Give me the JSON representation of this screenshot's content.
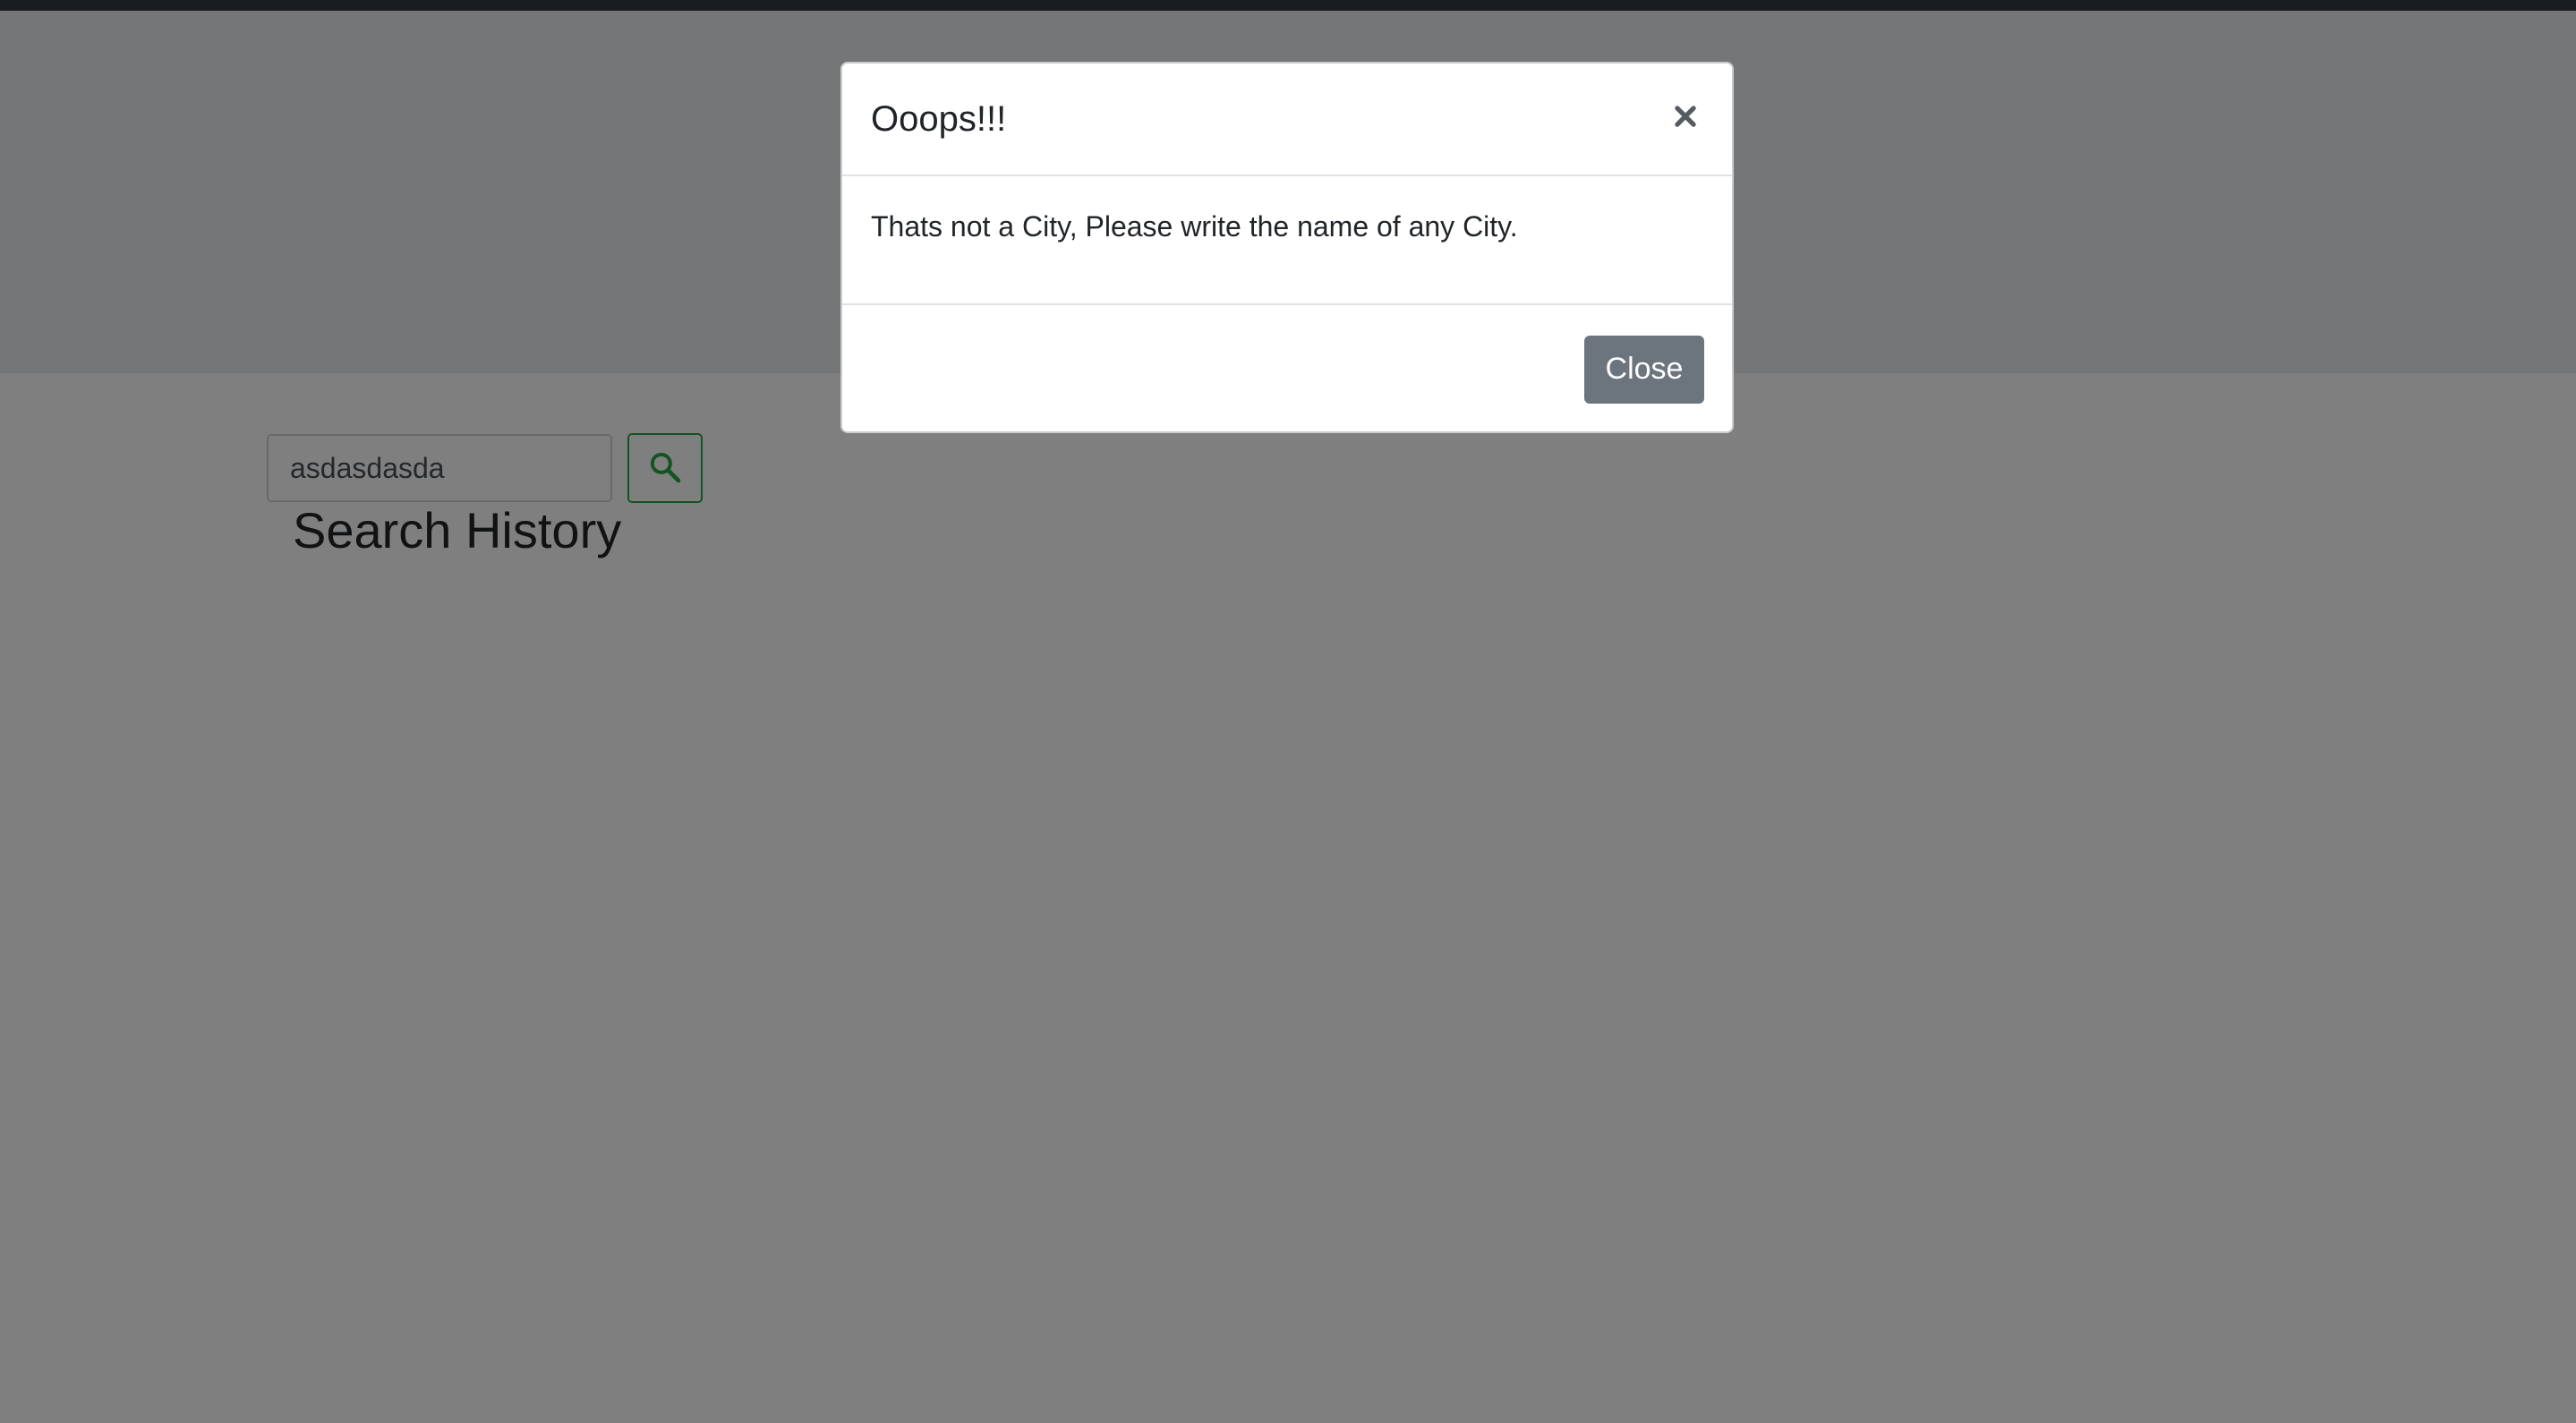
{
  "search": {
    "value": "asdasdasda",
    "button_icon": "search-icon",
    "button_color": "#28a745"
  },
  "history": {
    "title": "Search History"
  },
  "modal": {
    "title": "Ooops!!!",
    "close_icon": "close-icon",
    "message": "Thats not a City, Please write the name of any City.",
    "close_label": "Close",
    "close_button_color": "#6c757d"
  },
  "colors": {
    "backdrop": "rgba(0,0,0,0.5)",
    "top_bar": "#343a40",
    "hero": "#e9ecef"
  }
}
